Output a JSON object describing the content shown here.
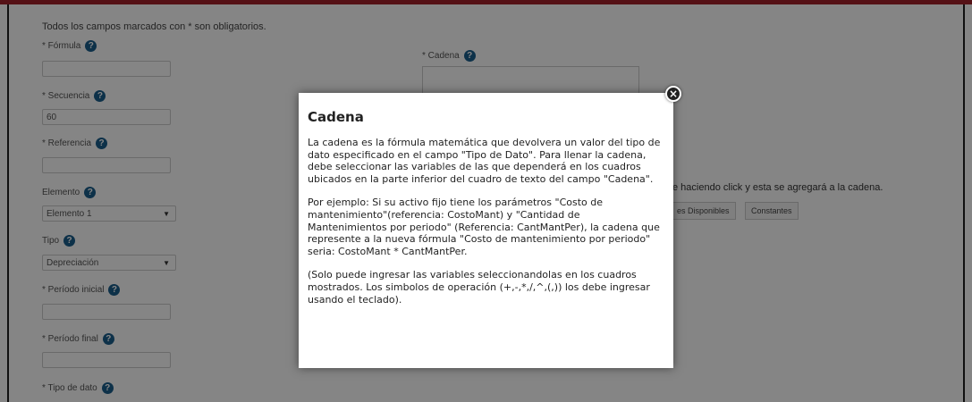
{
  "form": {
    "required_note": "Todos los campos marcados con * son obligatorios.",
    "fields": {
      "formula": {
        "label": "* Fórmula",
        "value": ""
      },
      "secuencia": {
        "label": "* Secuencia",
        "value": "60"
      },
      "referencia": {
        "label": "* Referencia",
        "value": ""
      },
      "elemento": {
        "label": "Elemento",
        "value": "Elemento 1"
      },
      "tipo": {
        "label": "Tipo",
        "value": "Depreciación"
      },
      "periodo_inicial": {
        "label": "* Período inicial",
        "value": ""
      },
      "periodo_final": {
        "label": "* Período final",
        "value": ""
      },
      "tipo_dato": {
        "label": "* Tipo de dato"
      },
      "cadena": {
        "label": "* Cadena",
        "value": ""
      }
    },
    "help_glyph": "?",
    "select_caret": "▼",
    "variables_instruction": "e haciendo click y esta se agregará a la cadena.",
    "tabs": [
      "es Disponibles",
      "Constantes"
    ]
  },
  "modal": {
    "title": "Cadena",
    "paragraphs": [
      "La cadena es la fórmula matemática que devolvera un valor del tipo de dato especificado en el campo \"Tipo de Dato\". Para llenar la cadena, debe seleccionar las variables de las que dependerá en los cuadros ubicados en la parte inferior del cuadro de texto del campo \"Cadena\".",
      "Por ejemplo: Si su activo fijo tiene los parámetros \"Costo de mantenimiento\"(referencia: CostoMant) y \"Cantidad de Mantenimientos por periodo\" (Referencia: CantMantPer), la cadena que represente a la nueva fórmula \"Costo de mantenimiento por periodo\" seria: CostoMant * CantMantPer.",
      "(Solo puede ingresar las variables seleccionandolas en los cuadros mostrados. Los simbolos de operación (+,-,*,/,^,(,)) los debe ingresar usando el teclado)."
    ],
    "close_glyph": "×"
  },
  "colors": {
    "top_bar": "#a3212b",
    "help_icon": "#1a5e8c"
  }
}
